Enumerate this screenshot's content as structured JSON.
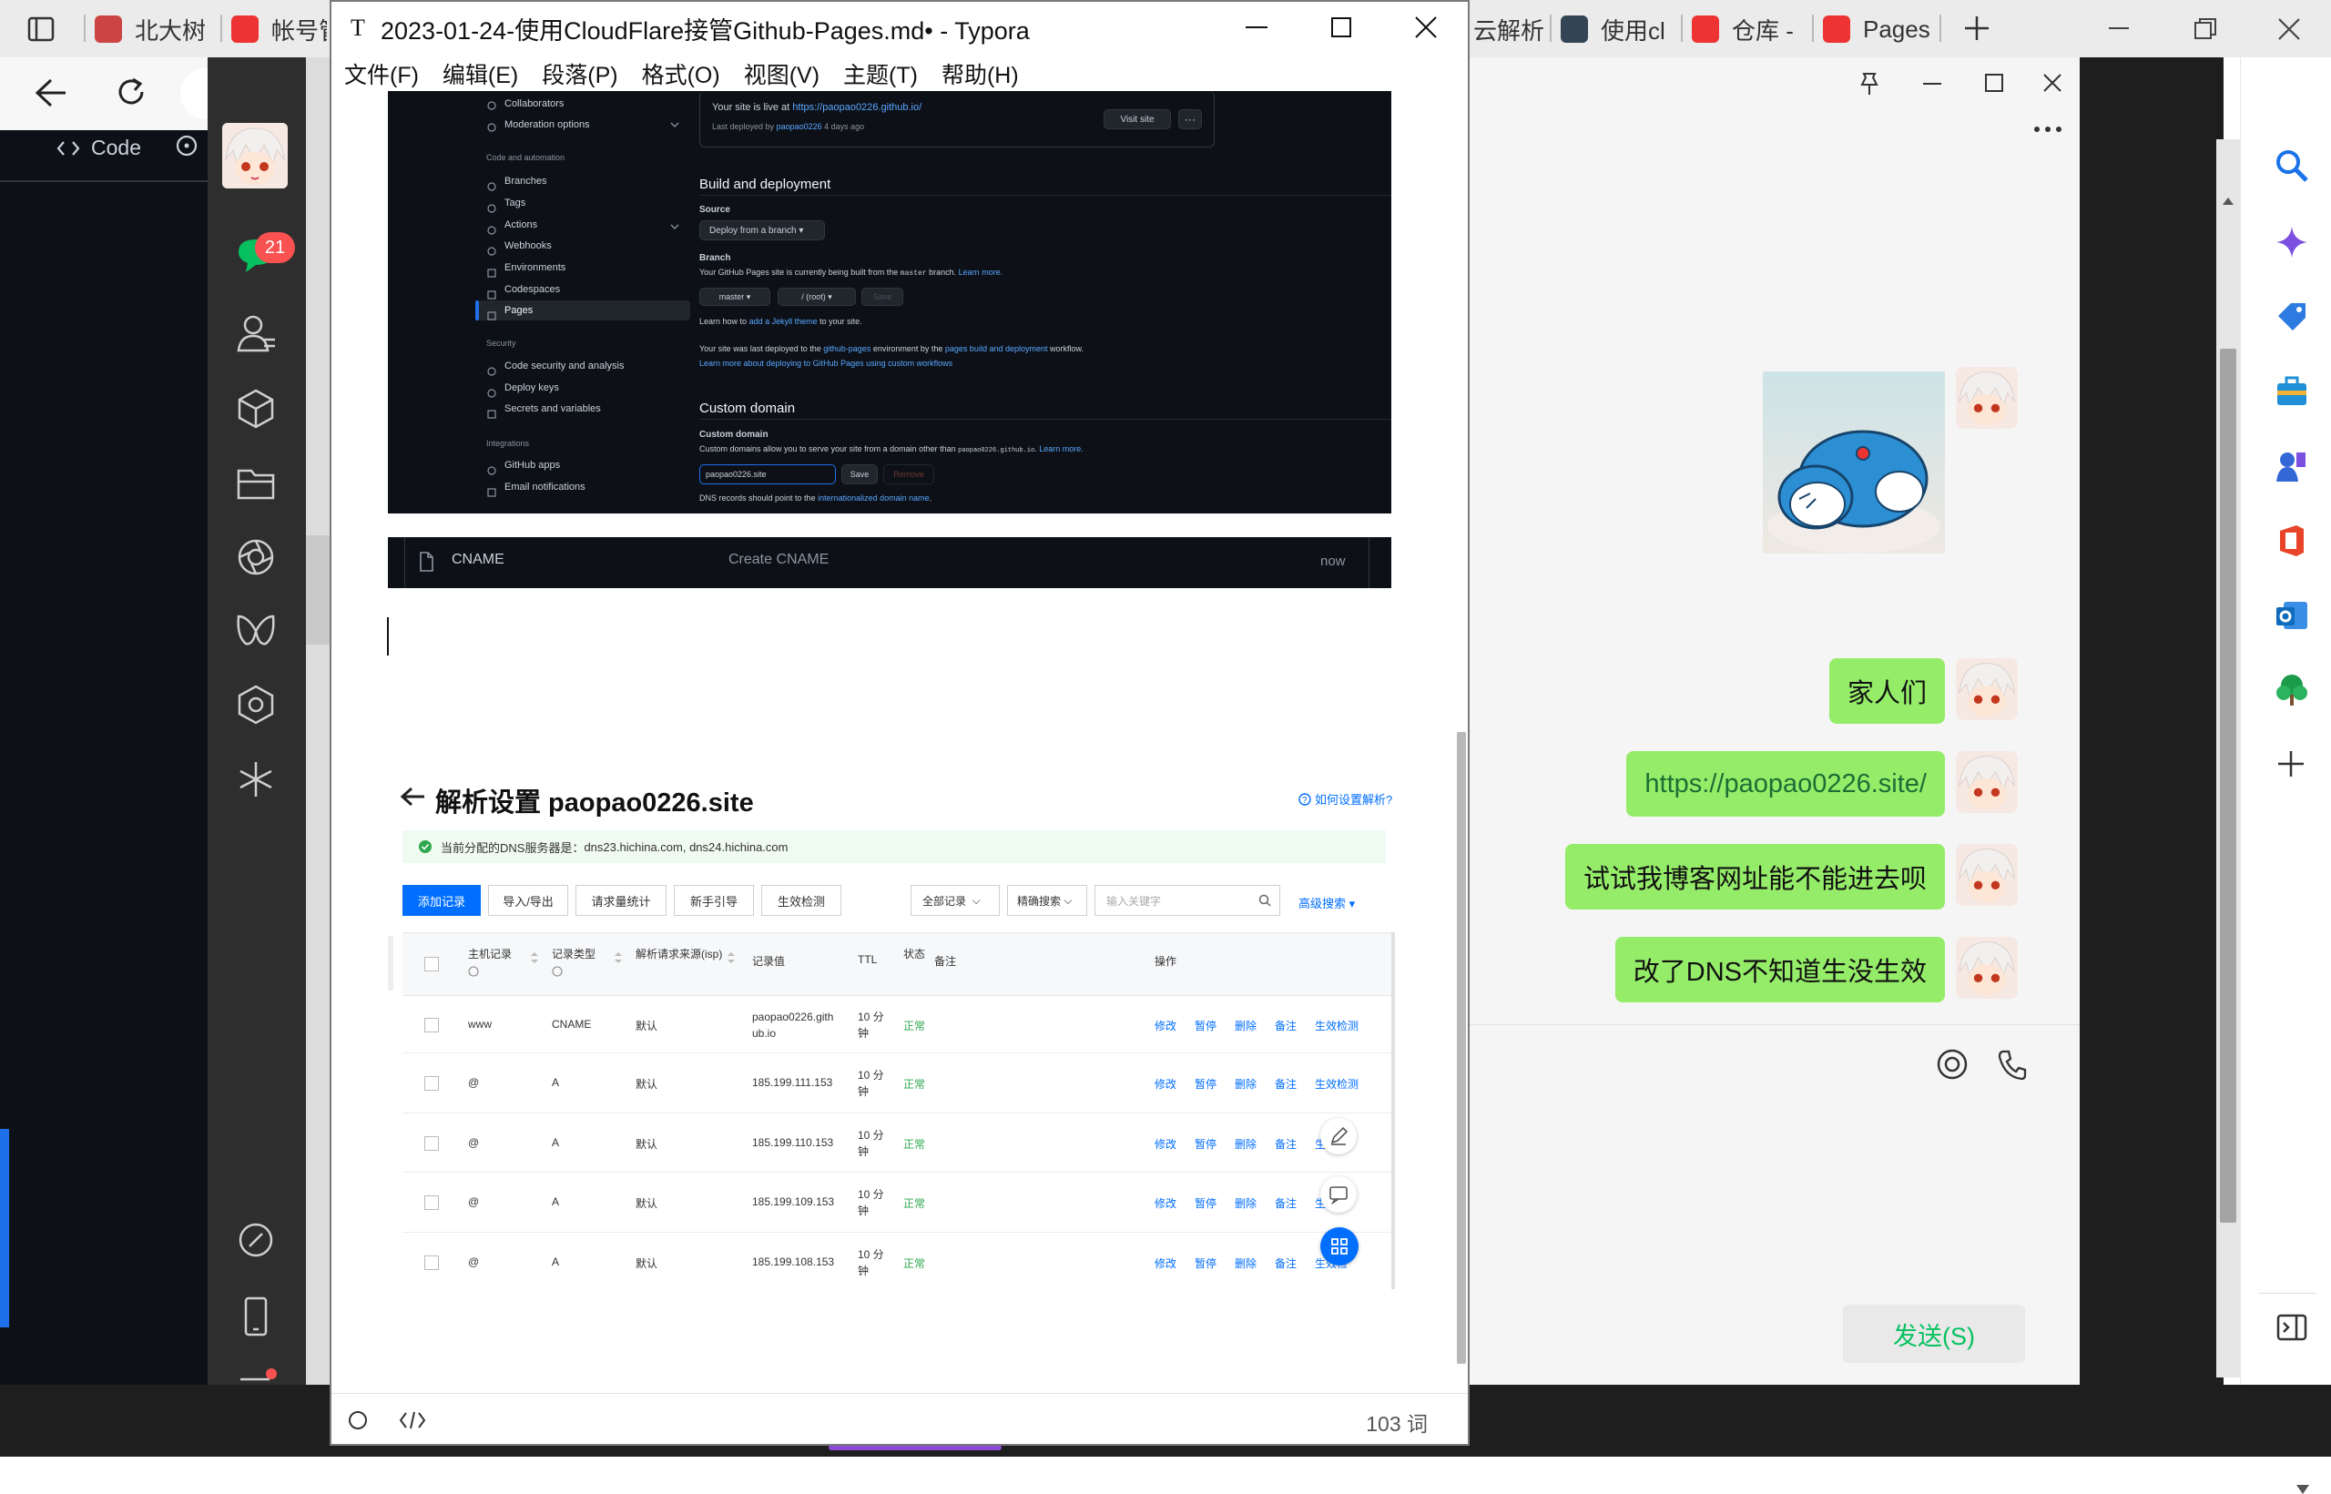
{
  "browser_tabs": [
    {
      "label": "北大树",
      "color": "#c44"
    },
    {
      "label": "帐号管",
      "color": "#e33"
    },
    {
      "label": "云解析",
      "color": "#3a7"
    },
    {
      "label": "使用cl",
      "color": "#345"
    },
    {
      "label": "仓库 -",
      "color": "#e33"
    },
    {
      "label": "Pages",
      "color": "#e33"
    }
  ],
  "github": {
    "code_label": "Code"
  },
  "wechat": {
    "unread_count": "21",
    "messages": [
      "家人们",
      "https://paopao0226.site/",
      "试试我博客网址能不能进去呗",
      "改了DNS不知道生没生效"
    ],
    "send_button": "发送(S)"
  },
  "typora": {
    "title": "2023-01-24-使用CloudFlare接管Github-Pages.md• - Typora",
    "menu": [
      "文件(F)",
      "编辑(E)",
      "段落(P)",
      "格式(O)",
      "视图(V)",
      "主题(T)",
      "帮助(H)"
    ],
    "word_count": "103 词"
  },
  "gh_settings": {
    "sidebar": {
      "top": [
        "Collaborators",
        "Moderation options"
      ],
      "section_code": "Code and automation",
      "code_items": [
        "Branches",
        "Tags",
        "Actions",
        "Webhooks",
        "Environments",
        "Codespaces",
        "Pages"
      ],
      "section_security": "Security",
      "security_items": [
        "Code security and analysis",
        "Deploy keys",
        "Secrets and variables"
      ],
      "section_integrations": "Integrations",
      "integration_items": [
        "GitHub apps",
        "Email notifications"
      ]
    },
    "live_text": "Your site is live at",
    "live_url": "https://paopao0226.github.io/",
    "deployed_text": "Last deployed by",
    "deployed_user": "paopao0226",
    "deployed_when": "4 days ago",
    "visit_site": "Visit site",
    "build_heading": "Build and deployment",
    "source_label": "Source",
    "source_value": "Deploy from a branch",
    "branch_label": "Branch",
    "branch_desc": "Your GitHub Pages site is currently being built from the",
    "branch_name": "master",
    "branch_desc2": "branch.",
    "learn_more": "Learn more.",
    "branch_btn": "master",
    "folder_btn": "/ (root)",
    "save_btn": "Save",
    "jekyll_text": "Learn how to",
    "jekyll_link": "add a Jekyll theme",
    "jekyll_text2": "to your site.",
    "deploy_env_text": "Your site was last deployed to the",
    "deploy_env_link": "github-pages",
    "deploy_env_text2": "environment by the",
    "deploy_env_link2": "pages build and deployment",
    "deploy_env_text3": "workflow.",
    "deploy_more_link": "Learn more about deploying to GitHub Pages using custom workflows",
    "custom_heading": "Custom domain",
    "custom_label": "Custom domain",
    "custom_desc": "Custom domains allow you to serve your site from a domain other than",
    "custom_domain_code": "paopao0226.github.io",
    "custom_input": "paopao0226.site",
    "remove_btn": "Remove",
    "dns_text": "DNS records should point to the",
    "dns_link": "internationalized domain name",
    "dns_text2": "."
  },
  "commit_row": {
    "file": "CNAME",
    "message": "Create CNAME",
    "time": "now"
  },
  "dns_panel": {
    "title": "解析设置 paopao0226.site",
    "help_link": "如何设置解析?",
    "server_note_label": "当前分配的DNS服务器是：",
    "server_note_value": "dns23.hichina.com, dns24.hichina.com",
    "buttons": [
      "添加记录",
      "导入/导出",
      "请求量统计",
      "新手引导",
      "生效检测"
    ],
    "filter_all": "全部记录",
    "filter_exact": "精确搜索",
    "search_placeholder": "输入关键字",
    "advanced_search": "高级搜索",
    "columns": [
      "主机记录",
      "记录类型",
      "解析请求来源(isp)",
      "记录值",
      "TTL",
      "状态",
      "备注",
      "操作"
    ],
    "rows": [
      {
        "host": "www",
        "type": "CNAME",
        "line": "默认",
        "value": "paopao0226.github.io",
        "ttl": "10 分钟",
        "status": "正常"
      },
      {
        "host": "@",
        "type": "A",
        "line": "默认",
        "value": "185.199.111.153",
        "ttl": "10 分钟",
        "status": "正常"
      },
      {
        "host": "@",
        "type": "A",
        "line": "默认",
        "value": "185.199.110.153",
        "ttl": "10 分钟",
        "status": "正常"
      },
      {
        "host": "@",
        "type": "A",
        "line": "默认",
        "value": "185.199.109.153",
        "ttl": "10 分钟",
        "status": "正常"
      },
      {
        "host": "@",
        "type": "A",
        "line": "默认",
        "value": "185.199.108.153",
        "ttl": "10 分钟",
        "status": "正常"
      }
    ],
    "actions": [
      "修改",
      "暂停",
      "删除",
      "备注",
      "生效检测"
    ]
  },
  "colors": {
    "wechat_green": "#95ec69",
    "link_blue": "#006eff",
    "gh_bg": "#0d1117"
  }
}
